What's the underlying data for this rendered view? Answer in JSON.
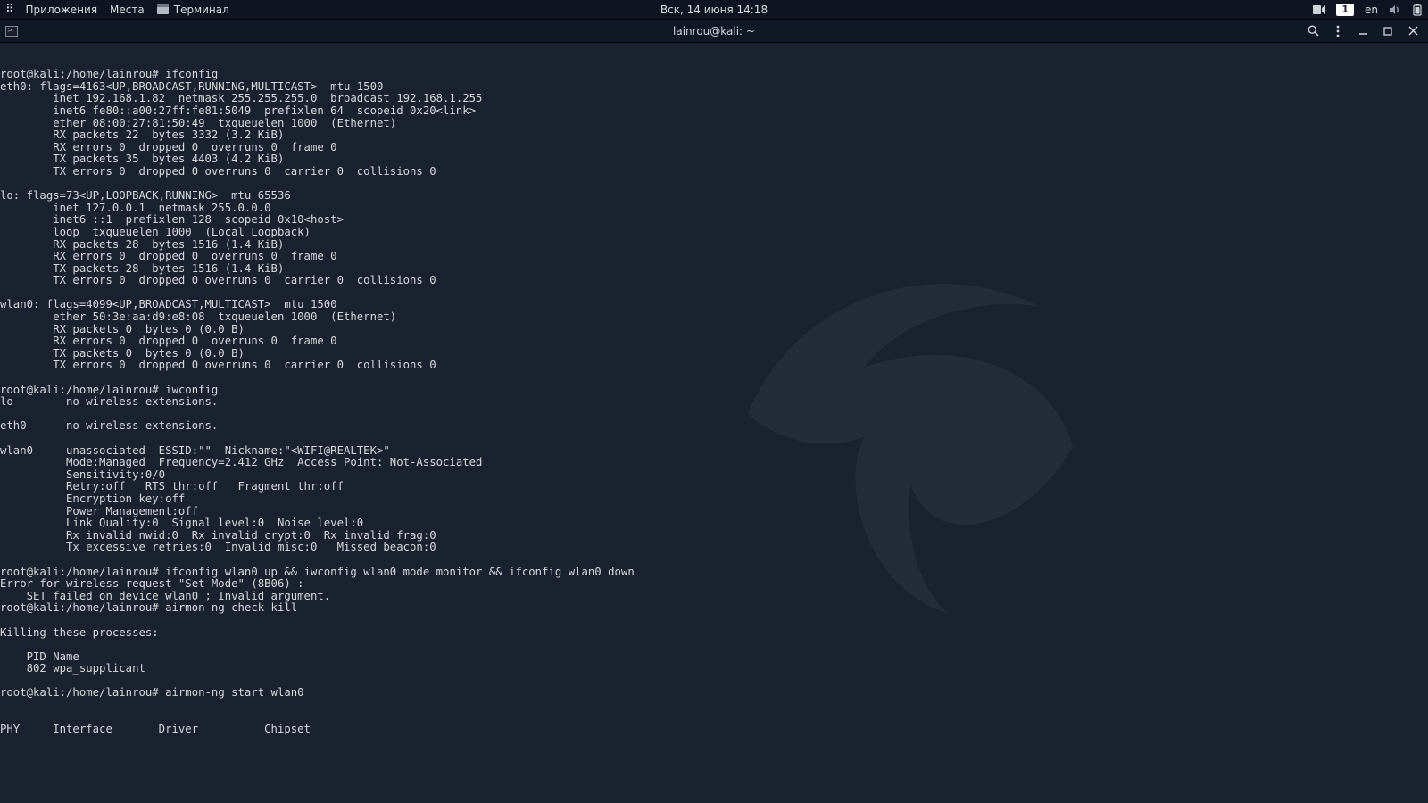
{
  "top_panel": {
    "activities_glyph": "⠿",
    "menu_apps": "Приложения",
    "menu_places": "Места",
    "menu_terminal": "Терминал",
    "clock": "Вск, 14 июня  14:18",
    "workspace_number": "1",
    "lang": "en"
  },
  "title_bar": {
    "title": "lainrou@kali: ~"
  },
  "terminal": {
    "prompt": "root@kali:/home/lainrou#",
    "cmd_ifconfig": "ifconfig",
    "ifconfig_output": "eth0: flags=4163<UP,BROADCAST,RUNNING,MULTICAST>  mtu 1500\n        inet 192.168.1.82  netmask 255.255.255.0  broadcast 192.168.1.255\n        inet6 fe80::a00:27ff:fe81:5049  prefixlen 64  scopeid 0x20<link>\n        ether 08:00:27:81:50:49  txqueuelen 1000  (Ethernet)\n        RX packets 22  bytes 3332 (3.2 KiB)\n        RX errors 0  dropped 0  overruns 0  frame 0\n        TX packets 35  bytes 4403 (4.2 KiB)\n        TX errors 0  dropped 0 overruns 0  carrier 0  collisions 0\n\nlo: flags=73<UP,LOOPBACK,RUNNING>  mtu 65536\n        inet 127.0.0.1  netmask 255.0.0.0\n        inet6 ::1  prefixlen 128  scopeid 0x10<host>\n        loop  txqueuelen 1000  (Local Loopback)\n        RX packets 28  bytes 1516 (1.4 KiB)\n        RX errors 0  dropped 0  overruns 0  frame 0\n        TX packets 28  bytes 1516 (1.4 KiB)\n        TX errors 0  dropped 0 overruns 0  carrier 0  collisions 0\n\nwlan0: flags=4099<UP,BROADCAST,MULTICAST>  mtu 1500\n        ether 50:3e:aa:d9:e8:08  txqueuelen 1000  (Ethernet)\n        RX packets 0  bytes 0 (0.0 B)\n        RX errors 0  dropped 0  overruns 0  frame 0\n        TX packets 0  bytes 0 (0.0 B)\n        TX errors 0  dropped 0 overruns 0  carrier 0  collisions 0\n",
    "cmd_iwconfig": "iwconfig",
    "iwconfig_output": "lo        no wireless extensions.\n\neth0      no wireless extensions.\n\nwlan0     unassociated  ESSID:\"\"  Nickname:\"<WIFI@REALTEK>\"\n          Mode:Managed  Frequency=2.412 GHz  Access Point: Not-Associated\n          Sensitivity:0/0\n          Retry:off   RTS thr:off   Fragment thr:off\n          Encryption key:off\n          Power Management:off\n          Link Quality:0  Signal level:0  Noise level:0\n          Rx invalid nwid:0  Rx invalid crypt:0  Rx invalid frag:0\n          Tx excessive retries:0  Invalid misc:0   Missed beacon:0\n",
    "cmd_mode": "ifconfig wlan0 up && iwconfig wlan0 mode monitor && ifconfig wlan0 down",
    "mode_error": "Error for wireless request \"Set Mode\" (8B06) :\n    SET failed on device wlan0 ; Invalid argument.",
    "cmd_checkkill": "airmon-ng check kill",
    "checkkill_output": "\nKilling these processes:\n\n    PID Name\n    802 wpa_supplicant\n",
    "cmd_start": "airmon-ng start wlan0",
    "start_output": "\n\nPHY     Interface       Driver          Chipset"
  }
}
